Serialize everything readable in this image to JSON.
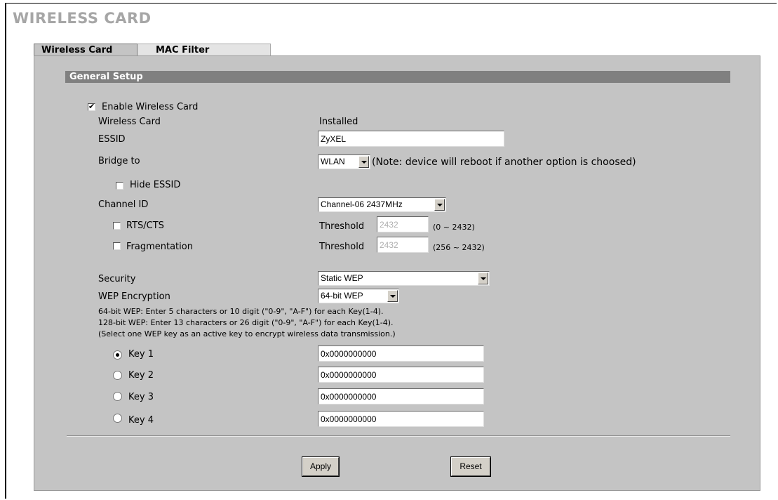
{
  "page": {
    "title": "WIRELESS CARD"
  },
  "tabs": [
    {
      "label": "Wireless Card",
      "active": true
    },
    {
      "label": "MAC Filter",
      "active": false
    }
  ],
  "section": {
    "title": "General Setup"
  },
  "form": {
    "enable_wireless_card": {
      "label": "Enable Wireless Card",
      "checked": true
    },
    "wireless_card": {
      "label": "Wireless Card",
      "value": "Installed"
    },
    "essid": {
      "label": "ESSID",
      "value": "ZyXEL"
    },
    "bridge_to": {
      "label": "Bridge to",
      "value": "WLAN",
      "note": "(Note: device will reboot if another option is choosed)"
    },
    "hide_essid": {
      "label": "Hide ESSID",
      "checked": false
    },
    "channel_id": {
      "label": "Channel ID",
      "value": "Channel-06 2437MHz"
    },
    "rts_cts": {
      "label": "RTS/CTS",
      "checked": false,
      "threshold_label": "Threshold",
      "threshold_value": "2432",
      "range": "(0 ~ 2432)"
    },
    "fragmentation": {
      "label": "Fragmentation",
      "checked": false,
      "threshold_label": "Threshold",
      "threshold_value": "2432",
      "range": "(256 ~ 2432)"
    },
    "security": {
      "label": "Security",
      "value": "Static WEP"
    },
    "wep_encryption": {
      "label": "WEP Encryption",
      "value": "64-bit WEP"
    },
    "wep_notes": [
      "64-bit WEP: Enter 5 characters or 10 digit (\"0-9\", \"A-F\") for each Key(1-4).",
      "128-bit WEP: Enter 13 characters or 26 digit (\"0-9\", \"A-F\") for each Key(1-4).",
      "(Select one WEP key as an active key to encrypt wireless data transmission.)"
    ],
    "keys": [
      {
        "label": "Key 1",
        "value": "0x0000000000",
        "selected": true
      },
      {
        "label": "Key 2",
        "value": "0x0000000000",
        "selected": false
      },
      {
        "label": "Key 3",
        "value": "0x0000000000",
        "selected": false
      },
      {
        "label": "Key 4",
        "value": "0x0000000000",
        "selected": false
      }
    ]
  },
  "buttons": {
    "apply": "Apply",
    "reset": "Reset"
  }
}
